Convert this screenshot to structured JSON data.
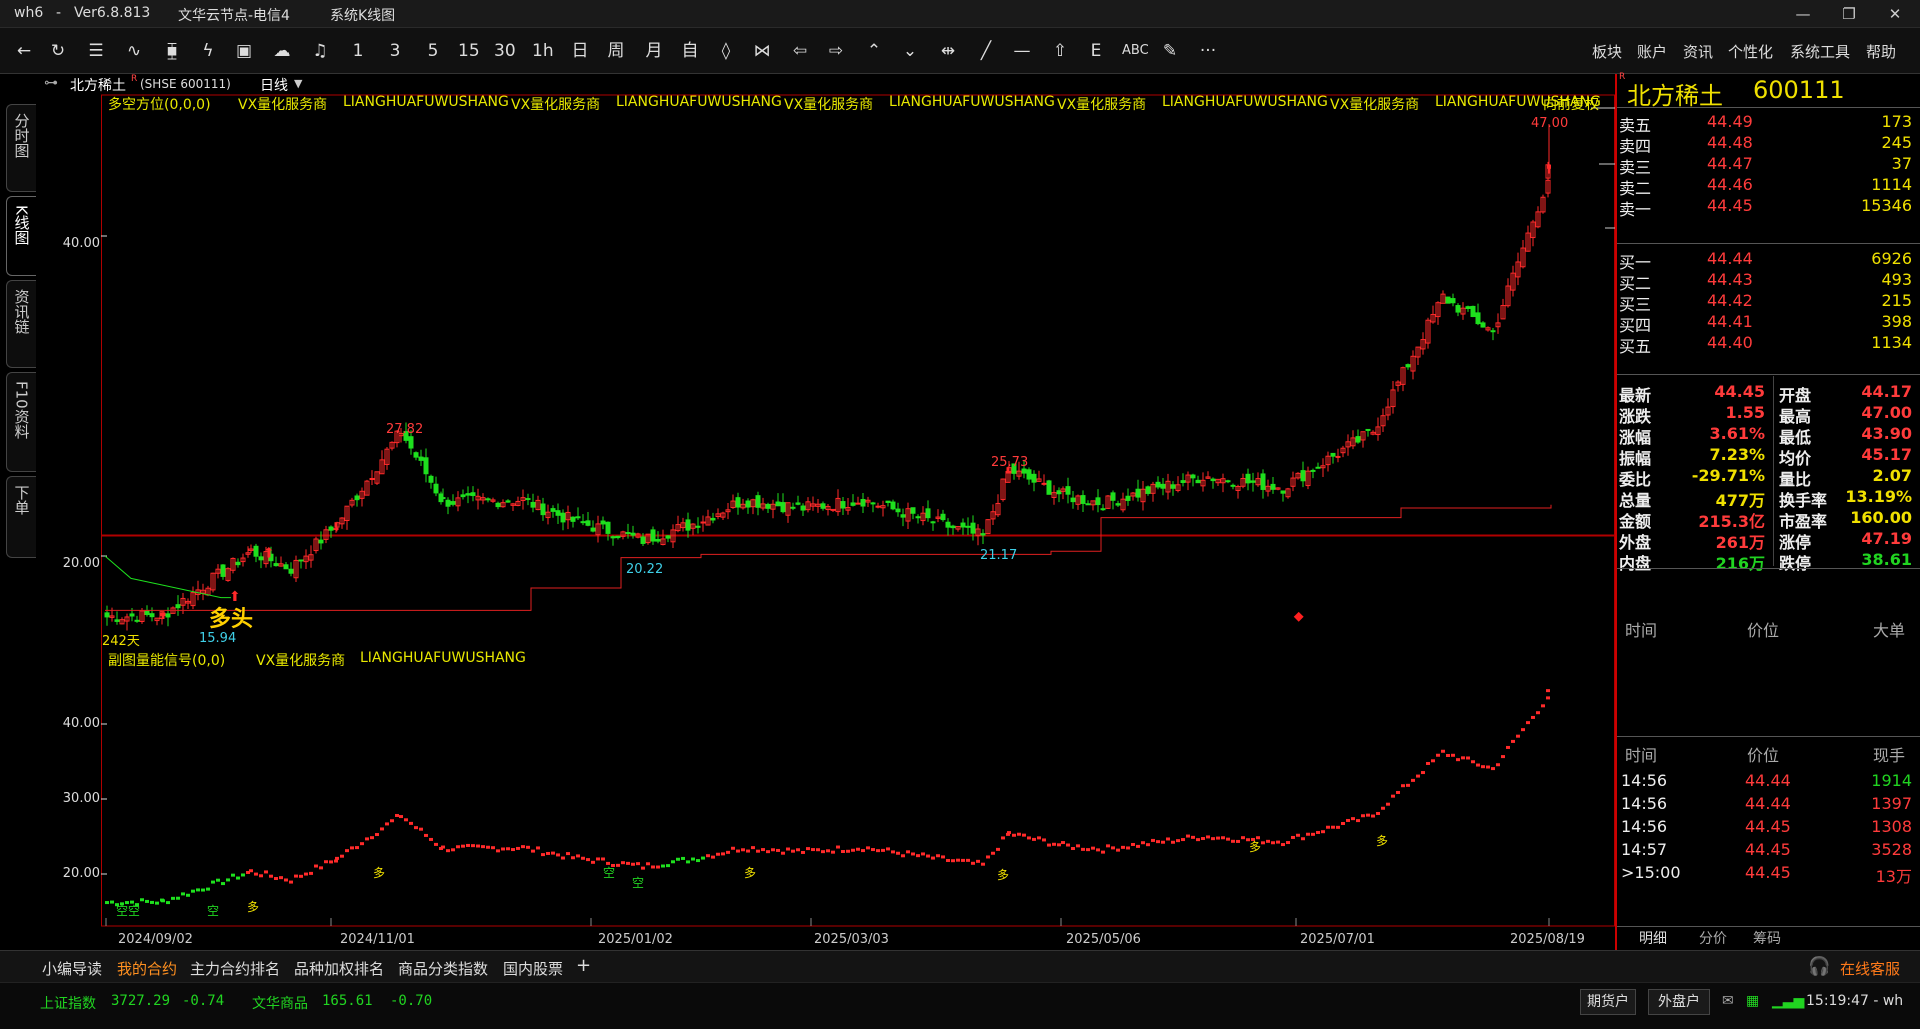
{
  "window": {
    "app": "wh6",
    "version": "Ver6.8.813",
    "server": "文华云节点-电信4",
    "view": "系统K线图",
    "icons": [
      "minimize-icon",
      "maximize-icon",
      "close-icon"
    ]
  },
  "toolbar": {
    "periods": [
      "1",
      "3",
      "5",
      "15",
      "30",
      "1h",
      "日",
      "周",
      "月",
      "自"
    ],
    "menus": [
      "板块",
      "账户",
      "资讯",
      "个性化",
      "系统工具",
      "帮助"
    ]
  },
  "left_tabs": [
    "分时图",
    "K线图",
    "资讯链",
    "F10资料",
    "下单"
  ],
  "chart_header": {
    "symbol_line": "北方稀土",
    "flag": "R",
    "code": "(SHSE 600111)",
    "period": "日线"
  },
  "main_indicator": {
    "name": "多空方位(0,0,0)",
    "text1": "VX量化服务商",
    "text2": "LIANGHUAFUWUSHANG",
    "text3": "VX量化服务商",
    "text4": "LIANGHUAFUWUSHANG",
    "text5": "VX量化服务商",
    "text6": "LIANGHUAFUWUSHANG",
    "text7": "VX量化服务商",
    "text8": "LIANGHUAFUWUSHANG",
    "text9": "VX量化服务商",
    "text10": "LIANGHUAFUWUSHANG",
    "right": "向前复权"
  },
  "sub_indicator": {
    "name": "副图量能信号(0,0)",
    "text1": "VX量化服务商",
    "text2": "LIANGHUAFUWUSHANG"
  },
  "main_axis": [
    "40.00",
    "20.00"
  ],
  "sub_axis": [
    "40.00",
    "30.00",
    "20.00"
  ],
  "annotations": {
    "high": "47.00",
    "p1": "27.82",
    "p2": "25.73",
    "p3": "20.22",
    "p4": "21.17",
    "p5": "15.94",
    "days": "242天",
    "signal": "多头"
  },
  "sub_marks": {
    "duo": "多",
    "kong": "空"
  },
  "dates": [
    "2024/09/02",
    "2024/11/01",
    "2025/01/02",
    "2025/03/03",
    "2025/05/06",
    "2025/07/01",
    "2025/08/19"
  ],
  "quote": {
    "name": "北方稀土",
    "code": "600111",
    "flag": "R",
    "asks": [
      {
        "label": "卖五",
        "price": "44.49",
        "vol": "173"
      },
      {
        "label": "卖四",
        "price": "44.48",
        "vol": "245"
      },
      {
        "label": "卖三",
        "price": "44.47",
        "vol": "37"
      },
      {
        "label": "卖二",
        "price": "44.46",
        "vol": "1114"
      },
      {
        "label": "卖一",
        "price": "44.45",
        "vol": "15346"
      }
    ],
    "bids": [
      {
        "label": "买一",
        "price": "44.44",
        "vol": "6926"
      },
      {
        "label": "买二",
        "price": "44.43",
        "vol": "493"
      },
      {
        "label": "买三",
        "price": "44.42",
        "vol": "215"
      },
      {
        "label": "买四",
        "price": "44.41",
        "vol": "398"
      },
      {
        "label": "买五",
        "price": "44.40",
        "vol": "1134"
      }
    ],
    "stats": [
      {
        "l": "最新",
        "v": "44.45",
        "c": "red",
        "l2": "开盘",
        "v2": "44.17",
        "c2": "red"
      },
      {
        "l": "涨跌",
        "v": "1.55",
        "c": "red",
        "l2": "最高",
        "v2": "47.00",
        "c2": "red"
      },
      {
        "l": "涨幅",
        "v": "3.61%",
        "c": "red",
        "l2": "最低",
        "v2": "43.90",
        "c2": "red"
      },
      {
        "l": "振幅",
        "v": "7.23%",
        "c": "yel",
        "l2": "均价",
        "v2": "45.17",
        "c2": "red"
      },
      {
        "l": "委比",
        "v": "-29.71%",
        "c": "yel",
        "l2": "量比",
        "v2": "2.07",
        "c2": "yel"
      },
      {
        "l": "总量",
        "v": "477万",
        "c": "yel",
        "l2": "换手率",
        "v2": "13.19%",
        "c2": "yel"
      },
      {
        "l": "金额",
        "v": "215.3亿",
        "c": "red",
        "l2": "市盈率",
        "v2": "160.00",
        "c2": "yel"
      },
      {
        "l": "外盘",
        "v": "261万",
        "c": "red",
        "l2": "涨停",
        "v2": "47.19",
        "c2": "red"
      },
      {
        "l": "内盘",
        "v": "216万",
        "c": "grn",
        "l2": "跌停",
        "v2": "38.61",
        "c2": "grn"
      }
    ],
    "bigorder_header": [
      "时间",
      "价位",
      "大单"
    ],
    "ticks_header": [
      "时间",
      "价位",
      "现手"
    ],
    "ticks": [
      {
        "t": "14:56",
        "p": "44.44",
        "v": "1914",
        "c": "grn"
      },
      {
        "t": "14:56",
        "p": "44.44",
        "v": "1397",
        "c": "red"
      },
      {
        "t": "14:56",
        "p": "44.45",
        "v": "1308",
        "c": "red"
      },
      {
        "t": "14:57",
        "p": "44.45",
        "v": "3528",
        "c": "red"
      },
      {
        "t": ">15:00",
        "p": "44.45",
        "v": "13万",
        "c": "red"
      }
    ],
    "tabs": [
      "明细",
      "分价",
      "筹码"
    ]
  },
  "bottom_tabs": [
    "小编导读",
    "我的合约",
    "主力合约排名",
    "品种加权排名",
    "商品分类指数",
    "国内股票",
    "+"
  ],
  "service": "在线客服",
  "status": {
    "idx1_name": "上证指数",
    "idx1": "3727.29",
    "idx1_chg": "-0.74",
    "idx2_name": "文华商品",
    "idx2": "165.61",
    "idx2_chg": "-0.70",
    "btn1": "期货户",
    "btn2": "外盘户",
    "time": "15:19:47 - wh"
  },
  "chart_data": {
    "type": "candlestick",
    "price_axis_ticks": [
      20,
      40
    ],
    "sub_axis_ticks": [
      20,
      30,
      40
    ],
    "x_ticks": [
      "2024/09/02",
      "2024/11/01",
      "2025/01/02",
      "2025/03/03",
      "2025/05/06",
      "2025/07/01",
      "2025/08/19"
    ],
    "series_close": [
      {
        "date": "2024/09/02",
        "close": 16.2
      },
      {
        "date": "2024/09/24",
        "close": 16.3
      },
      {
        "date": "2024/10/08",
        "close": 20.3
      },
      {
        "date": "2024/10/18",
        "close": 19.2
      },
      {
        "date": "2024/11/01",
        "close": 22.0
      },
      {
        "date": "2024/11/08",
        "close": 27.8
      },
      {
        "date": "2024/11/20",
        "close": 23.4
      },
      {
        "date": "2024/12/10",
        "close": 23.5
      },
      {
        "date": "2024/12/25",
        "close": 22.2
      },
      {
        "date": "2025/01/02",
        "close": 21.0
      },
      {
        "date": "2025/01/20",
        "close": 22.0
      },
      {
        "date": "2025/02/10",
        "close": 23.5
      },
      {
        "date": "2025/03/03",
        "close": 23.0
      },
      {
        "date": "2025/03/25",
        "close": 23.5
      },
      {
        "date": "2025/04/08",
        "close": 21.2
      },
      {
        "date": "2025/04/15",
        "close": 25.4
      },
      {
        "date": "2025/05/06",
        "close": 23.8
      },
      {
        "date": "2025/06/01",
        "close": 23.3
      },
      {
        "date": "2025/06/20",
        "close": 25.0
      },
      {
        "date": "2025/07/01",
        "close": 24.3
      },
      {
        "date": "2025/07/10",
        "close": 27.8
      },
      {
        "date": "2025/07/25",
        "close": 36.2
      },
      {
        "date": "2025/08/05",
        "close": 34.0
      },
      {
        "date": "2025/08/19",
        "close": 44.45
      }
    ],
    "stop_line": [
      16.6,
      16.6,
      18.0,
      19.9,
      20.1,
      20.3,
      22.4,
      23.0,
      23.2
    ],
    "high": 47.0,
    "low": 15.94
  }
}
